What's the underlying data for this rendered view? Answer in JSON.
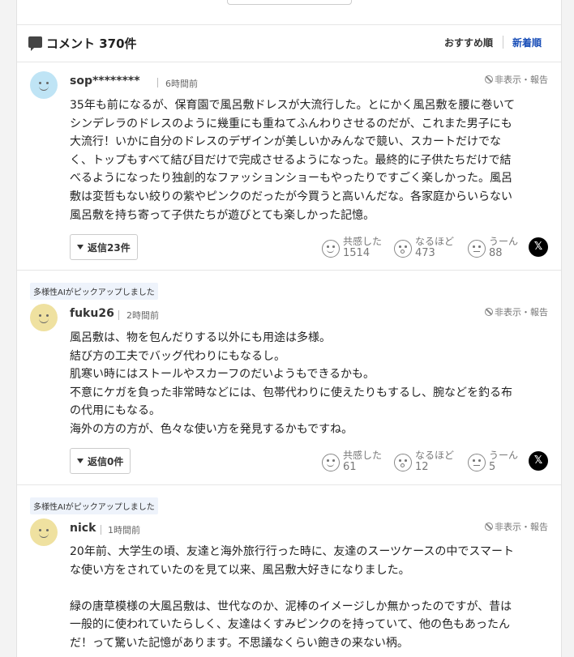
{
  "header": {
    "title": "コメント 370件",
    "sort_recommended": "おすすめ順",
    "sort_newest": "新着順"
  },
  "report_label": "非表示・報告",
  "reactions": {
    "empathy": "共感した",
    "insight": "なるほど",
    "hmm": "うーん"
  },
  "x_icon_glyph": "𝕏",
  "comments": [
    {
      "ai_tag": "",
      "avatar_color": "#bfe4f5",
      "username": "sop********",
      "time": "6時間前",
      "lines": [
        "35年も前になるが、保育園で風呂敷ドレスが大流行した。とにかく風呂敷を腰に巻いて",
        "シンデレラのドレスのように幾重にも重ねてふんわりさせるのだが、これまた男子にも",
        "大流行！いかに自分のドレスのデザインが美しいかみんなで競い、スカートだけでな",
        "く、トップもすべて結び目だけで完成させるようになった。最終的に子供たちだけで結",
        "べるようになったり独創的なファッションショーもやったりですごく楽しかった。風呂",
        "敷は変哲もない絞りの紫やピンクのだったが今買うと高いんだな。各家庭からいらない",
        "風呂敷を持ち寄って子供たちが遊びとても楽しかった記憶。"
      ],
      "reply_label": "返信23件",
      "empathy_count": "1514",
      "insight_count": "473",
      "hmm_count": "88"
    },
    {
      "ai_tag": "多様性AIがピックアップしました",
      "avatar_color": "#efe1a0",
      "username": "fuku26",
      "time": "2時間前",
      "lines": [
        "風呂敷は、物を包んだりする以外にも用途は多様。",
        "結び方の工夫でバッグ代わりにもなるし。",
        "肌寒い時にはストールやスカーフのだいようもできるかも。",
        "不意にケガを負った非常時などには、包帯代わりに使えたりもするし、腕などを釣る布",
        "の代用にもなる。",
        "海外の方の方が、色々な使い方を発見するかもですね。"
      ],
      "reply_label": "返信0件",
      "empathy_count": "61",
      "insight_count": "12",
      "hmm_count": "5"
    },
    {
      "ai_tag": "多様性AIがピックアップしました",
      "avatar_color": "#efe1a0",
      "username": "nick",
      "time": "1時間前",
      "lines": [
        "20年前、大学生の頃、友達と海外旅行行った時に、友達のスーツケースの中でスマート",
        "な使い方をされていたのを見て以来、風呂敷大好きになりました。",
        "",
        "緑の唐草模様の大風呂敷は、世代なのか、泥棒のイメージしか無かったのですが、昔は",
        "一般的に使われていたらしく、友達はくすみピンクのを持っていて、他の色もあったん",
        "だ！って驚いた記憶があります。不思議なくらい飽きの来ない柄。"
      ]
    }
  ]
}
